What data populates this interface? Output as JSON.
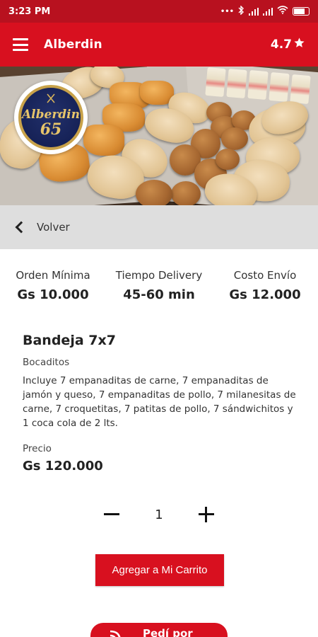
{
  "status_bar": {
    "time": "3:23 PM",
    "dots": "•••"
  },
  "app_bar": {
    "title": "Alberdin",
    "rating": "4.7",
    "rating_icon": "star-icon"
  },
  "hero": {
    "logo_text": "Alberdin",
    "logo_number": "65"
  },
  "back": {
    "label": "Volver"
  },
  "info": [
    {
      "label": "Orden Mínima",
      "value": "Gs 10.000"
    },
    {
      "label": "Tiempo Delivery",
      "value": "45-60 min"
    },
    {
      "label": "Costo Envío",
      "value": "Gs 12.000"
    }
  ],
  "product": {
    "name": "Bandeja 7x7",
    "category": "Bocaditos",
    "description": "Incluye 7 empanaditas de carne, 7 empanaditas de jamón y queso, 7 empanaditas de pollo, 7 milanesitas de carne, 7 croquetitas, 7 patitas de pollo, 7 sándwichitos y 1 coca cola de 2 lts.",
    "price_label": "Precio",
    "price": "Gs 120.000"
  },
  "quantity": {
    "value": "1"
  },
  "actions": {
    "add_to_cart": "Agregar a Mi Carrito",
    "pedi_por": "Pedí por"
  },
  "colors": {
    "brand_red": "#d8101f",
    "status_red": "#b8111f",
    "back_bar": "#dedede"
  }
}
